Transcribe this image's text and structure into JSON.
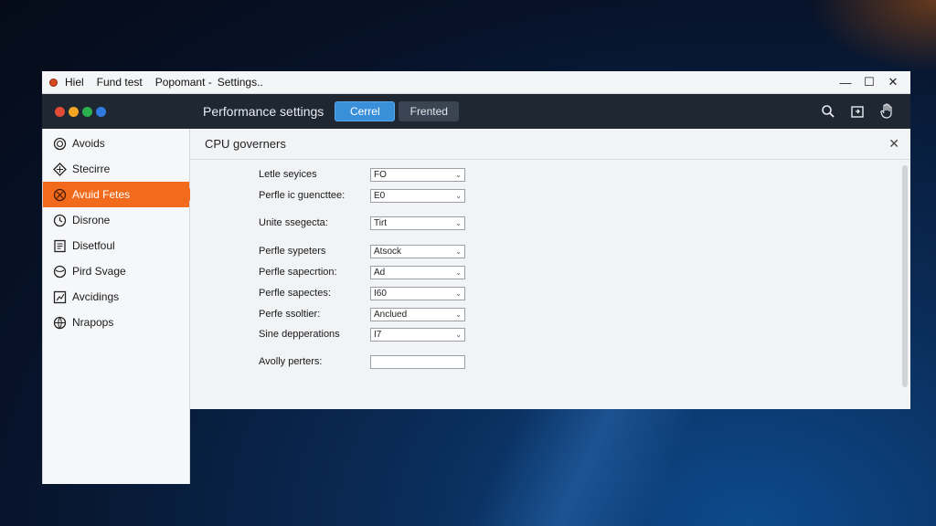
{
  "titlebar": {
    "items": [
      "Hiel",
      "Fund test",
      "Popomant -",
      "Settings.."
    ],
    "controls": {
      "minimize": "—",
      "maximize": "☐",
      "close": "✕"
    }
  },
  "toolbar": {
    "title": "Performance settings",
    "primary_label": "Cerrel",
    "secondary_label": "Frented",
    "dot_colors": [
      "#e24b35",
      "#f5a623",
      "#2bb24c",
      "#2f7be0"
    ],
    "icons": [
      "search-icon",
      "export-icon",
      "hand-icon"
    ]
  },
  "sidebar": {
    "items": [
      {
        "label": "Avoids",
        "icon": "avoid-icon",
        "active": false
      },
      {
        "label": "Stecirre",
        "icon": "settings-icon",
        "active": false
      },
      {
        "label": "Avuid Fetes",
        "icon": "fetes-icon",
        "active": true
      },
      {
        "label": "Disrone",
        "icon": "clock-icon",
        "active": false
      },
      {
        "label": "Disetfoul",
        "icon": "document-icon",
        "active": false
      },
      {
        "label": "Pird Svage",
        "icon": "storage-icon",
        "active": false
      },
      {
        "label": "Avcidings",
        "icon": "chart-icon",
        "active": false
      },
      {
        "label": "Nrapops",
        "icon": "globe-icon",
        "active": false
      }
    ],
    "accent": "#f26b1d"
  },
  "main": {
    "header": "CPU governers",
    "fields": [
      {
        "label": "Letle seyices",
        "value": "FO"
      },
      {
        "label": "Perfle ic guencttee:",
        "value": "E0"
      },
      {
        "label": "Unite ssegecta:",
        "value": "Tirt"
      },
      {
        "label": "Perfle sypeters",
        "value": "Atsock"
      },
      {
        "label": "Perfle sapecrtion:",
        "value": "Ad"
      },
      {
        "label": "Perfle sapectes:",
        "value": "I60"
      },
      {
        "label": "Perfe ssoltier:",
        "value": "Anclued"
      },
      {
        "label": "Sine depperations",
        "value": "I7"
      },
      {
        "label": "Avolly perters:",
        "value": ""
      }
    ]
  }
}
